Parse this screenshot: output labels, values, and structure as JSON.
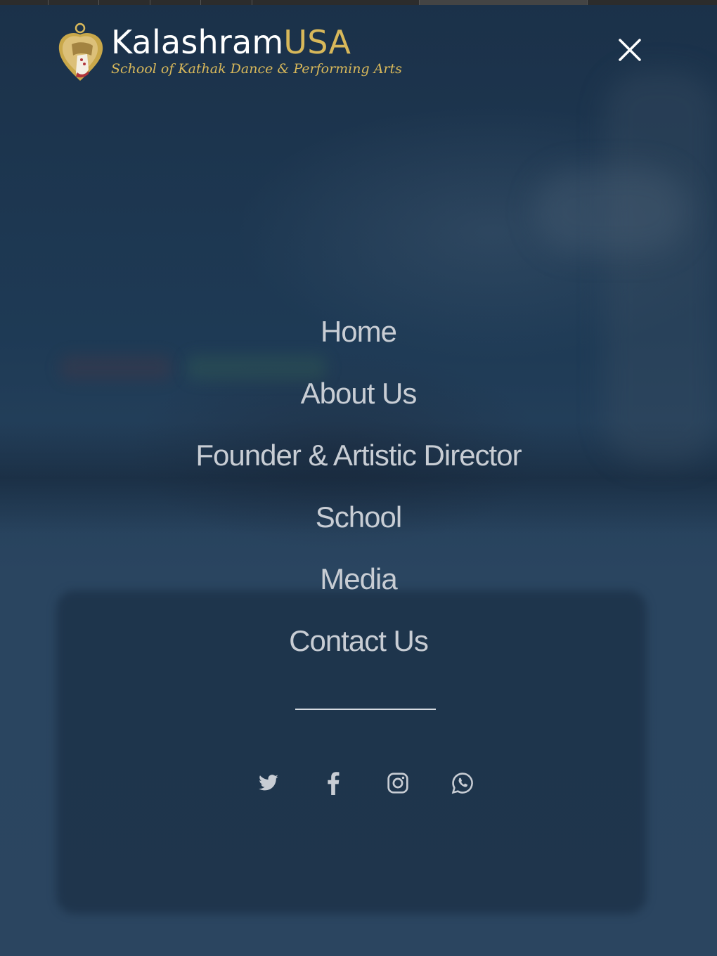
{
  "brand": {
    "name_part1": "Kalashram",
    "name_part2": "USA",
    "tagline": "School of Kathak Dance & Performing Arts",
    "gold": "#d8b85a"
  },
  "header": {
    "close_icon": "close-icon"
  },
  "nav": {
    "items": [
      {
        "label": "Home"
      },
      {
        "label": "About Us"
      },
      {
        "label": "Founder & Artistic Director"
      },
      {
        "label": "School"
      },
      {
        "label": "Media"
      },
      {
        "label": "Contact Us"
      }
    ]
  },
  "social": {
    "items": [
      {
        "icon": "twitter-icon"
      },
      {
        "icon": "facebook-icon"
      },
      {
        "icon": "instagram-icon"
      },
      {
        "icon": "whatsapp-icon"
      }
    ]
  },
  "colors": {
    "overlay_bg": "#1d344c",
    "menu_text": "#c8cdd4",
    "icon": "#c8cdd4"
  }
}
